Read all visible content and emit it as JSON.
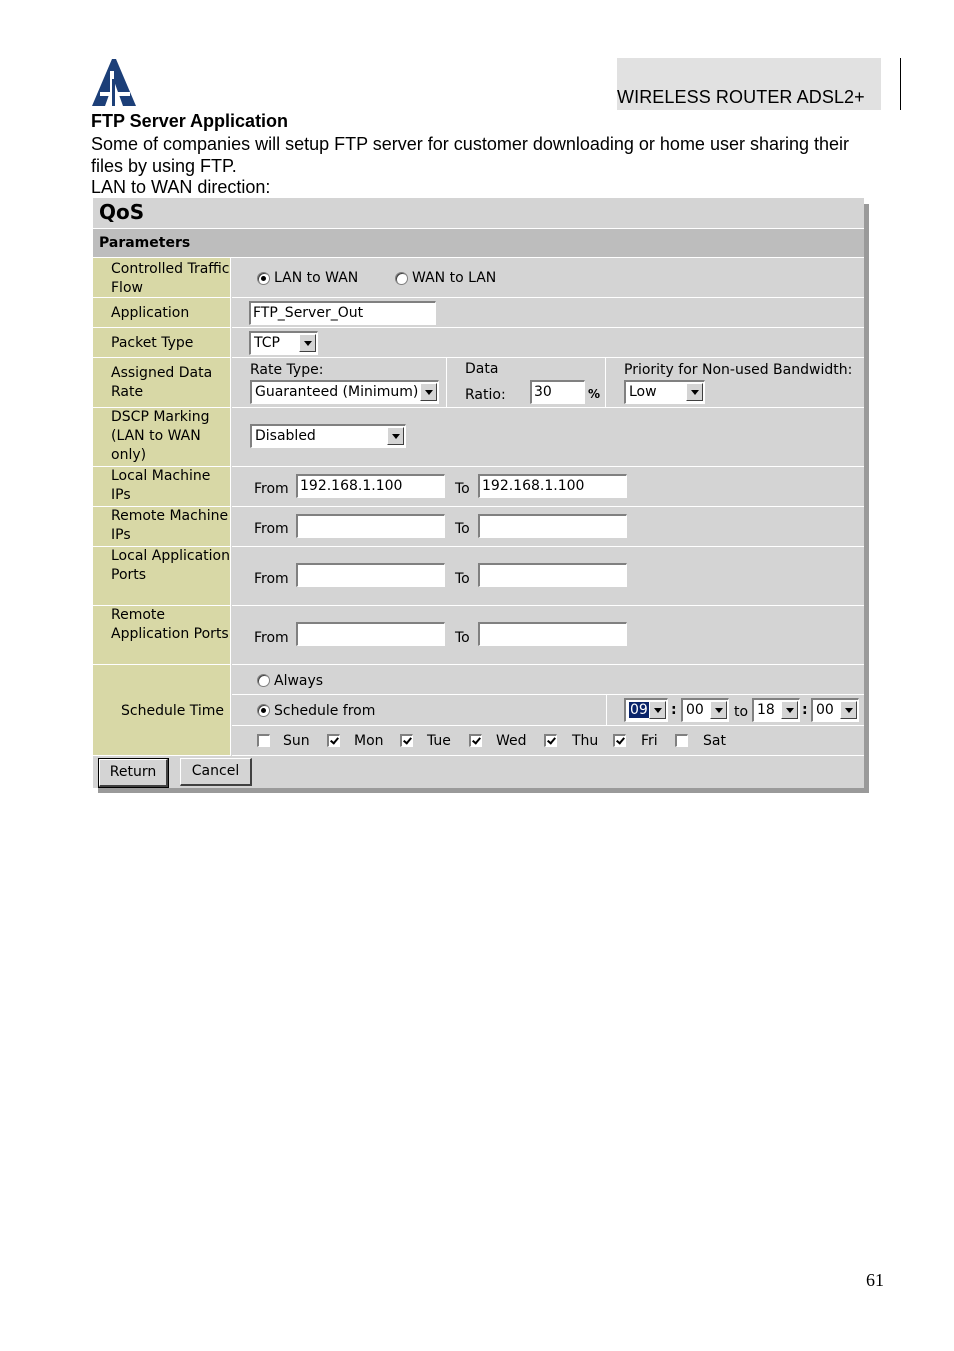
{
  "header": {
    "product": "WIRELESS ROUTER ADSL2+",
    "logo_icon": "atlantis-logo-icon"
  },
  "doc": {
    "title": "FTP Server Application",
    "paragraph": "Some of companies will setup FTP server for customer downloading or home user sharing their files by using FTP.",
    "direction": "LAN to WAN direction:"
  },
  "qos": {
    "title": "QoS",
    "section": "Parameters",
    "traffic_flow": {
      "label": "Controlled Traffic Flow",
      "options": [
        {
          "label": "LAN to WAN",
          "selected": true
        },
        {
          "label": "WAN to LAN",
          "selected": false
        }
      ]
    },
    "application": {
      "label": "Application",
      "value": "FTP_Server_Out"
    },
    "packet_type": {
      "label": "Packet Type",
      "value": "TCP"
    },
    "data_rate": {
      "label": "Assigned Data Rate",
      "rate_type_label": "Rate Type:",
      "rate_type_value": "Guaranteed (Minimum)",
      "data_label": "Data",
      "ratio_label": "Ratio:",
      "ratio_value": "30",
      "ratio_unit": "%",
      "priority_label": "Priority for Non-used Bandwidth:",
      "priority_value": "Low"
    },
    "dscp": {
      "label": "DSCP Marking (LAN to WAN only)",
      "value": "Disabled"
    },
    "local_ips": {
      "label": "Local Machine IPs",
      "from_label": "From",
      "from": "192.168.1.100",
      "to_label": "To",
      "to": "192.168.1.100"
    },
    "remote_ips": {
      "label": "Remote Machine IPs",
      "from_label": "From",
      "from": "",
      "to_label": "To",
      "to": ""
    },
    "local_ports": {
      "label": "Local Application Ports",
      "from_label": "From",
      "from": "",
      "to_label": "To",
      "to": ""
    },
    "remote_ports": {
      "label": "Remote Application Ports",
      "from_label": "From",
      "from": "",
      "to_label": "To",
      "to": ""
    },
    "schedule": {
      "label": "Schedule Time",
      "always_label": "Always",
      "always_selected": false,
      "from_label": "Schedule from",
      "from_selected": true,
      "start_hour": "09",
      "start_min": "00",
      "colon": ":",
      "to_label": "to",
      "end_hour": "18",
      "end_min": "00",
      "days": [
        {
          "label": "Sun",
          "checked": false
        },
        {
          "label": "Mon",
          "checked": true
        },
        {
          "label": "Tue",
          "checked": true
        },
        {
          "label": "Wed",
          "checked": true
        },
        {
          "label": "Thu",
          "checked": true
        },
        {
          "label": "Fri",
          "checked": true
        },
        {
          "label": "Sat",
          "checked": false
        }
      ]
    },
    "buttons": {
      "return": "Return",
      "cancel": "Cancel"
    }
  },
  "page_number": "61"
}
